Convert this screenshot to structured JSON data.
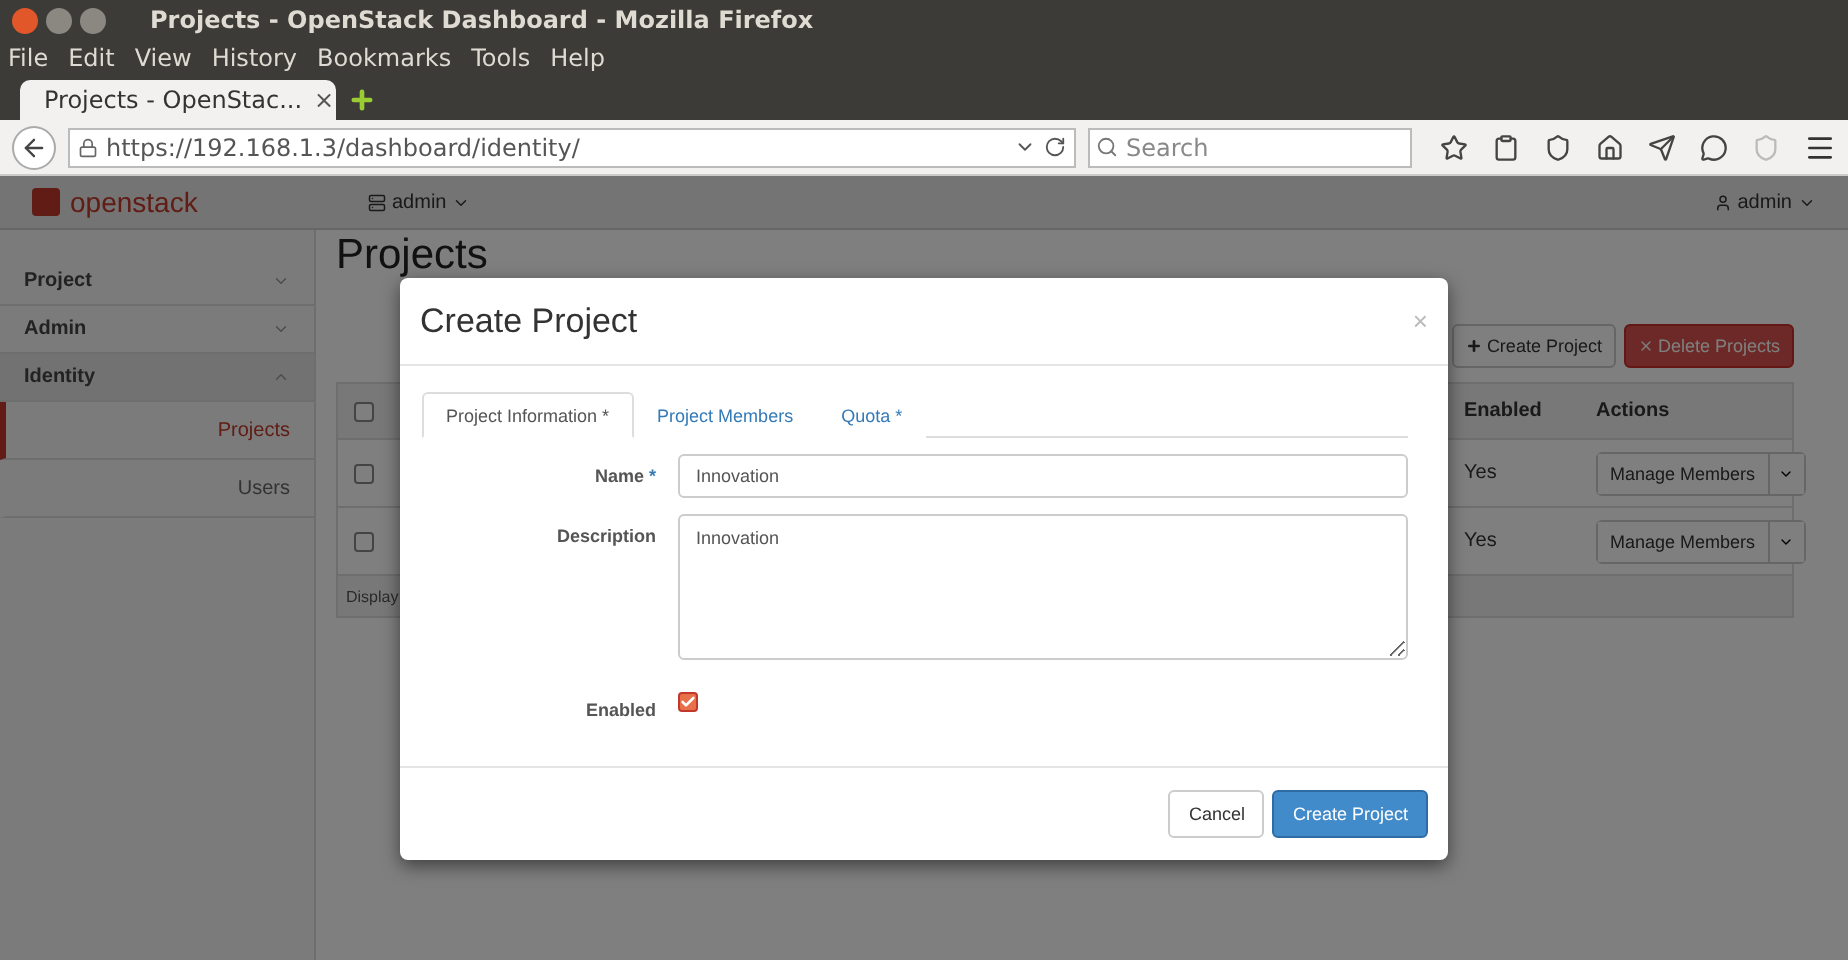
{
  "window": {
    "title": "Projects - OpenStack Dashboard - Mozilla Firefox"
  },
  "menu": [
    "File",
    "Edit",
    "View",
    "History",
    "Bookmarks",
    "Tools",
    "Help"
  ],
  "browser_tab": {
    "title": "Projects - OpenStac...",
    "close": "×"
  },
  "address": {
    "url": "https://192.168.1.3/dashboard/identity/"
  },
  "search": {
    "placeholder": "Search"
  },
  "header": {
    "logo": "openstack",
    "project": "admin",
    "user": "admin"
  },
  "sidebar": [
    {
      "label": "Project",
      "expanded": false
    },
    {
      "label": "Admin",
      "expanded": false
    },
    {
      "label": "Identity",
      "expanded": true,
      "children": [
        {
          "label": "Projects",
          "selected": true
        },
        {
          "label": "Users",
          "selected": false
        }
      ]
    }
  ],
  "page": {
    "heading": "Projects",
    "actions": [
      {
        "label": "Create Project",
        "kind": "add"
      },
      {
        "label": "Delete Projects",
        "kind": "delete"
      }
    ],
    "table": {
      "header_checked": false,
      "columns": [
        "Enabled",
        "Actions"
      ],
      "rows": [
        {
          "checked": false,
          "enabled": "Yes",
          "action": "Manage Members"
        },
        {
          "checked": false,
          "enabled": "Yes",
          "action": "Manage Members"
        }
      ],
      "footer": "Display"
    }
  },
  "dialog": {
    "title": "Create Project",
    "close": "×",
    "tabs": [
      {
        "label": "Project Information *",
        "selected": true
      },
      {
        "label": "Project Members",
        "selected": false
      },
      {
        "label": "Quota *",
        "selected": false
      }
    ],
    "fields": [
      {
        "kind": "text",
        "label": "Name",
        "required_mark": "*",
        "value": "Innovation"
      },
      {
        "kind": "textarea",
        "label": "Description",
        "value": "Innovation"
      },
      {
        "kind": "checkbox",
        "label": "Enabled",
        "checked": true
      }
    ],
    "buttons": [
      {
        "label": "Cancel",
        "primary": false
      },
      {
        "label": "Create Project",
        "primary": true
      }
    ]
  }
}
